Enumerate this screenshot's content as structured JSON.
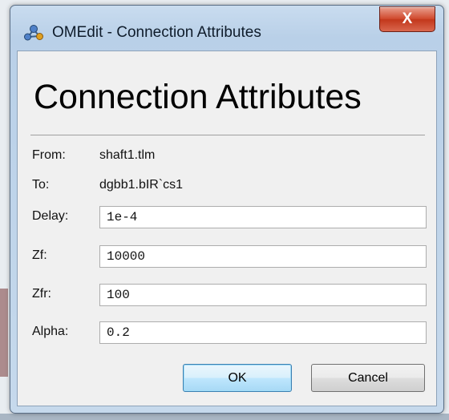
{
  "window": {
    "title": "OMEdit - Connection Attributes",
    "close_symbol": "X"
  },
  "dialog": {
    "heading": "Connection Attributes",
    "from_label": "From:",
    "from_value": "shaft1.tlm",
    "to_label": "To:",
    "to_value": "dgbb1.bIR`cs1",
    "fields": [
      {
        "label": "Delay:",
        "value": "1e-4"
      },
      {
        "label": "Zf:",
        "value": "10000"
      },
      {
        "label": "Zfr:",
        "value": "100"
      },
      {
        "label": "Alpha:",
        "value": "0.2"
      }
    ],
    "ok_label": "OK",
    "cancel_label": "Cancel"
  },
  "icons": {
    "app": "omedit-app-icon",
    "close": "close-icon"
  },
  "colors": {
    "titlebar": "#b9d0e8",
    "close_button": "#c2381c",
    "default_button_border": "#3c7fb1"
  }
}
